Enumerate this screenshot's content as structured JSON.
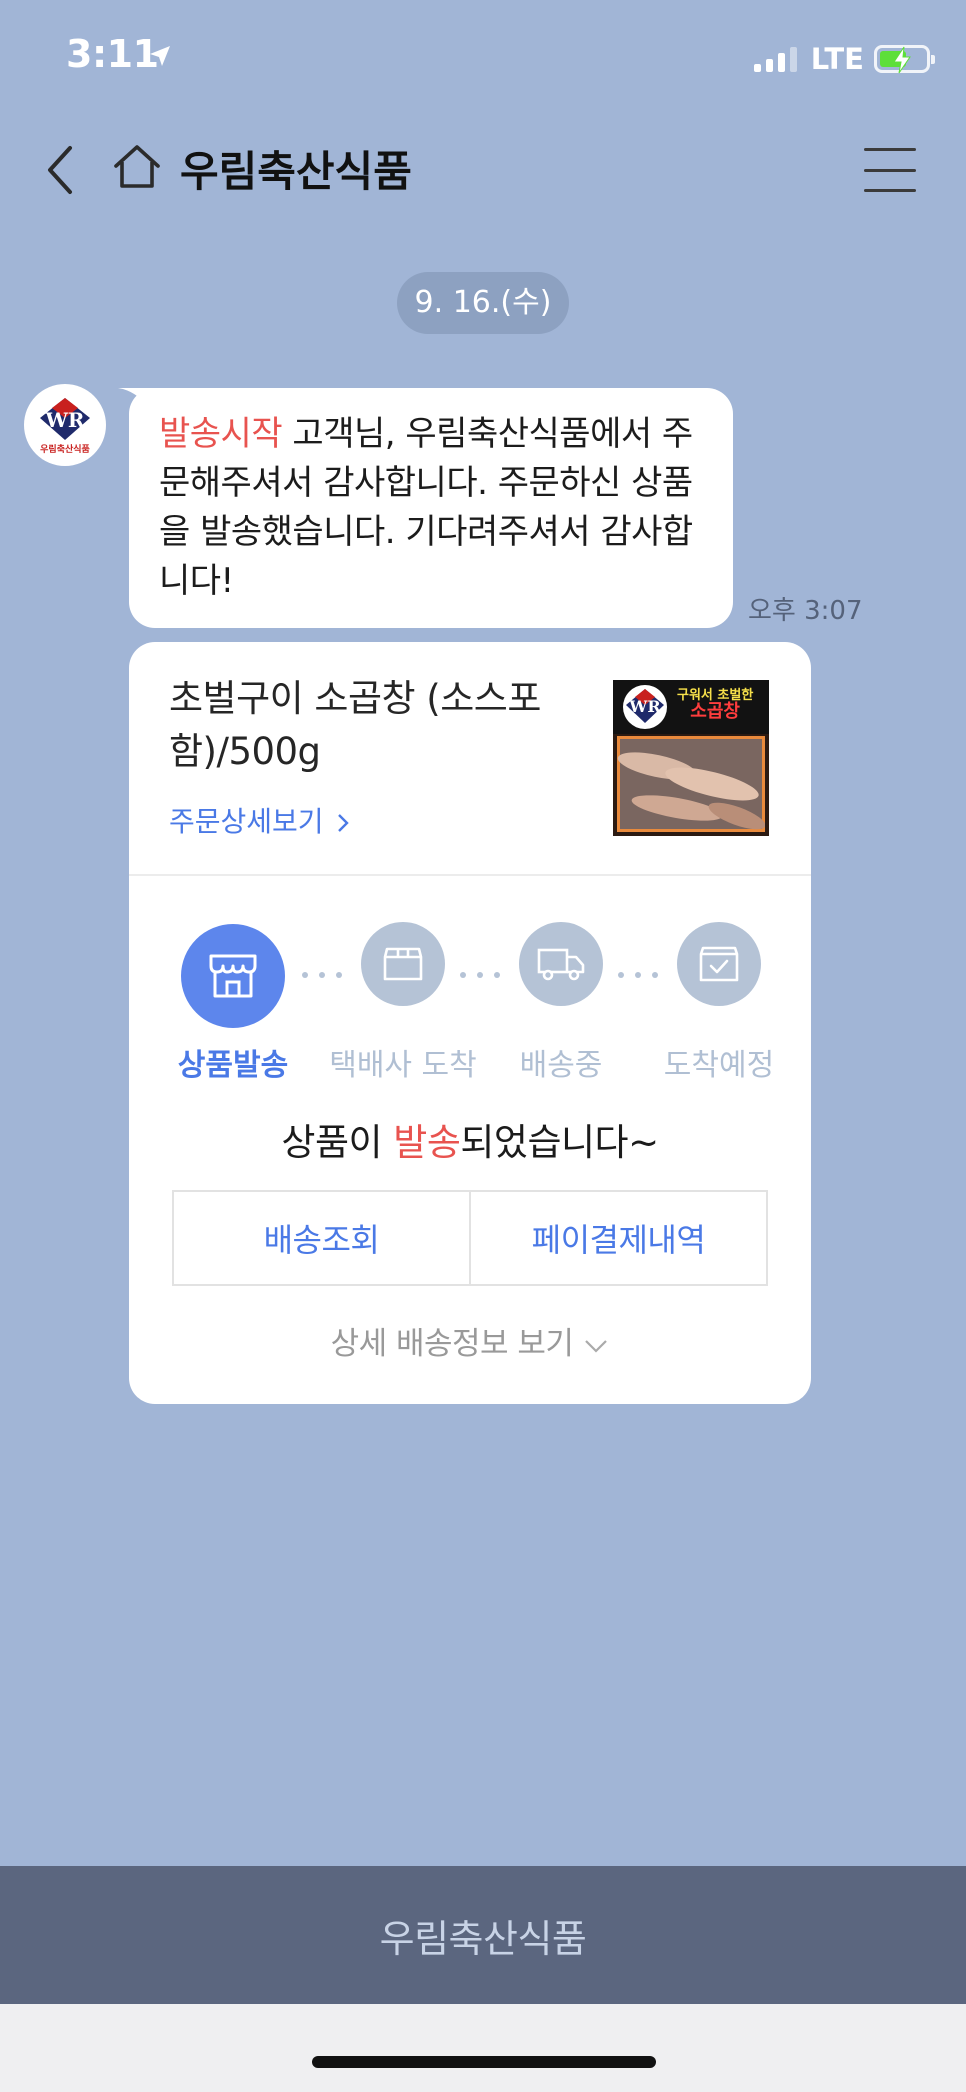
{
  "status_bar": {
    "time": "3:11",
    "network": "LTE",
    "icons": [
      "location-arrow-icon",
      "signal-icon",
      "battery-charging-icon"
    ]
  },
  "header": {
    "title": "우림축산식품",
    "icons": [
      "back-chevron-icon",
      "home-icon",
      "menu-icon"
    ]
  },
  "chat": {
    "date": "9. 16.(수)",
    "message": {
      "highlight": "발송시작",
      "text": " 고객님, 우림축산식품에서 주문해주셔서 감사합니다. 주문하신 상품을 발송했습니다. 기다려주셔서 감사합니다!",
      "time": "오후 3:07"
    }
  },
  "avatar": {
    "logo_letters": "WR",
    "logo_text": "우림축산식품"
  },
  "order_card": {
    "product_name": "초벌구이 소곱창 (소스포함)/500g",
    "detail_link": "주문상세보기",
    "thumbnail": {
      "logo_letters": "WR",
      "caption_top": "구워서 초벌한",
      "caption_bottom": "소곱창"
    },
    "steps": [
      {
        "label": "상품발송",
        "icon": "store-icon",
        "active": true
      },
      {
        "label": "택배사 도착",
        "icon": "box-icon",
        "active": false
      },
      {
        "label": "배송중",
        "icon": "truck-icon",
        "active": false
      },
      {
        "label": "도착예정",
        "icon": "package-check-icon",
        "active": false
      }
    ],
    "status_prefix": "상품이 ",
    "status_highlight": "발송",
    "status_suffix": "되었습니다~",
    "buttons": {
      "track": "배송조회",
      "payment": "페이결제내역"
    },
    "more_info": "상세 배송정보 보기"
  },
  "bottom_bar": {
    "label": "우림축산식품"
  },
  "colors": {
    "background": "#a1b5d6",
    "accent": "#4a79e6",
    "highlight": "#e8534f",
    "step_active": "#5d86ec",
    "step_inactive": "#b5c3d6",
    "bottom_bar": "#5b667f"
  }
}
